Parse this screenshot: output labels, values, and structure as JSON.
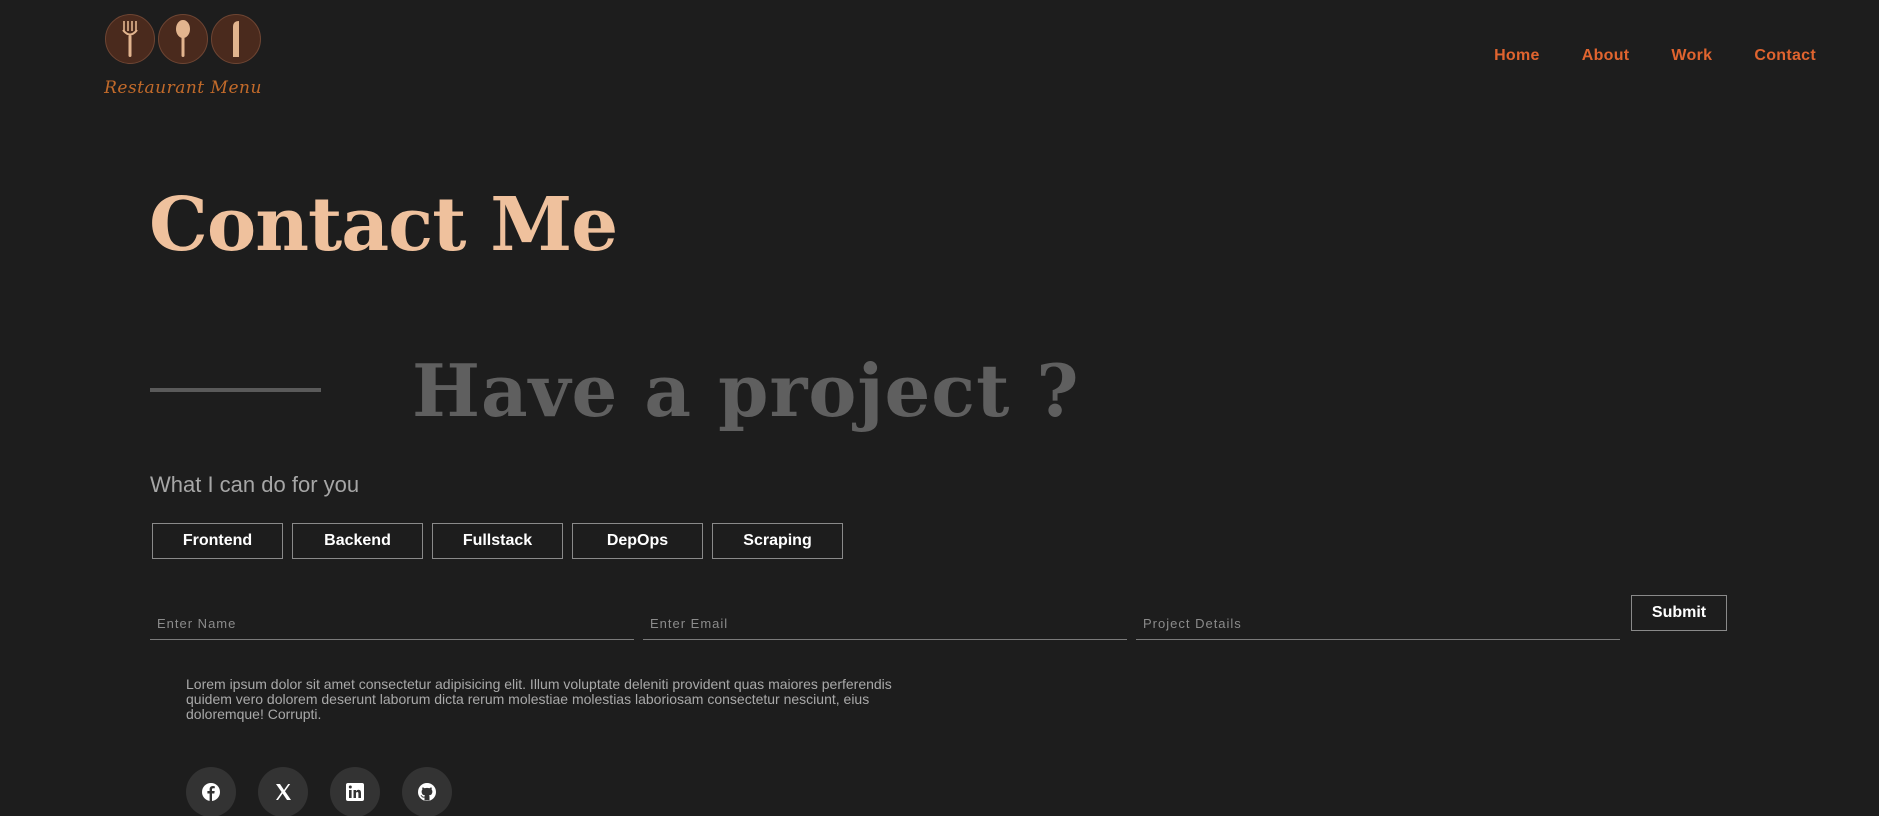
{
  "logo": {
    "text": "Restaurant Menu"
  },
  "nav": {
    "items": [
      "Home",
      "About",
      "Work",
      "Contact"
    ]
  },
  "page_title": "Contact Me",
  "subtitle": "Have a project ?",
  "services": {
    "label": "What I can do for you",
    "items": [
      "Frontend",
      "Backend",
      "Fullstack",
      "DepOps",
      "Scraping"
    ]
  },
  "form": {
    "name_placeholder": "Enter Name",
    "email_placeholder": "Enter Email",
    "details_placeholder": "Project Details",
    "submit_label": "Submit"
  },
  "paragraph": "Lorem ipsum dolor sit amet consectetur adipisicing elit. Illum voluptate deleniti provident quas maiores perferendis quidem vero dolorem deserunt laborum dicta rerum molestiae molestias laboriosam consectetur nesciunt, eius doloremque! Corrupti.",
  "socials": [
    "facebook-icon",
    "x-icon",
    "linkedin-icon",
    "github-icon"
  ],
  "colors": {
    "background": "#1d1d1d",
    "nav_accent": "#e0642f",
    "title": "#efc19d",
    "subtitle": "#5f5f5f"
  }
}
